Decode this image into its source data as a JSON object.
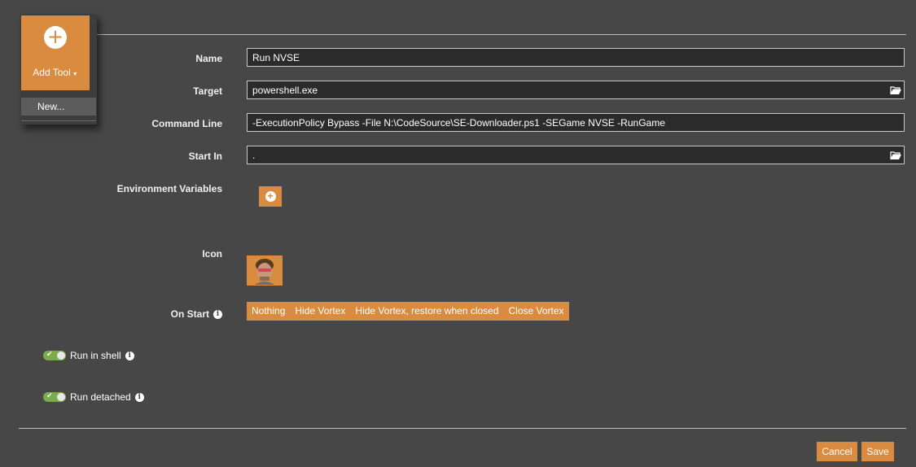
{
  "colors": {
    "accent": "#d98b3f",
    "background": "#474747",
    "toggle_on": "#7cab4a",
    "field_bg": "#2b2b2b"
  },
  "add_tool": {
    "label": "Add Tool",
    "icon": "plus-circle-icon",
    "menu": [
      {
        "label": "New..."
      }
    ]
  },
  "form": {
    "name": {
      "label": "Name",
      "value": "Run NVSE"
    },
    "target": {
      "label": "Target",
      "value": "powershell.exe",
      "icon": "folder-open-icon"
    },
    "command_line": {
      "label": "Command Line",
      "value": "-ExecutionPolicy Bypass -File N:\\CodeSource\\SE-Downloader.ps1 -SEGame NVSE -RunGame"
    },
    "start_in": {
      "label": "Start In",
      "value": ".",
      "icon": "folder-open-icon"
    },
    "environment_variables": {
      "label": "Environment Variables",
      "add_icon": "plus-circle-icon"
    },
    "icon": {
      "label": "Icon",
      "image": "character-portrait-icon"
    },
    "on_start": {
      "label": "On Start",
      "options": [
        "Nothing",
        "Hide Vortex",
        "Hide Vortex, restore when closed",
        "Close Vortex"
      ]
    },
    "run_in_shell": {
      "label": "Run in shell",
      "enabled": true
    },
    "run_detached": {
      "label": "Run detached",
      "enabled": true
    }
  },
  "footer": {
    "cancel_label": "Cancel",
    "save_label": "Save"
  }
}
